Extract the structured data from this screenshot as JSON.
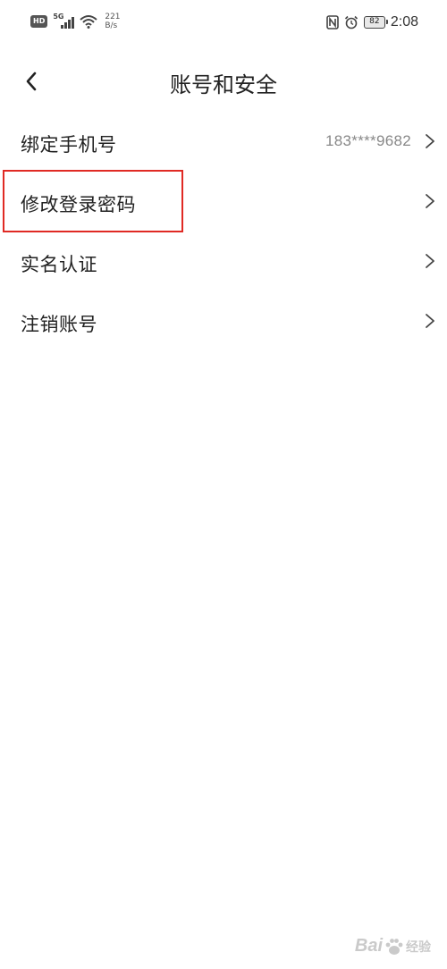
{
  "status_bar": {
    "hd": "HD",
    "network": "5G",
    "speed_value": "221",
    "speed_unit": "B/s",
    "battery": "82",
    "time": "2:08"
  },
  "header": {
    "title": "账号和安全"
  },
  "settings": {
    "items": [
      {
        "label": "绑定手机号",
        "value": "183****9682"
      },
      {
        "label": "修改登录密码",
        "value": ""
      },
      {
        "label": "实名认证",
        "value": ""
      },
      {
        "label": "注销账号",
        "value": ""
      }
    ]
  },
  "highlight_color": "#e02a24",
  "watermark": {
    "brand": "Bai",
    "suffix": "经验"
  }
}
